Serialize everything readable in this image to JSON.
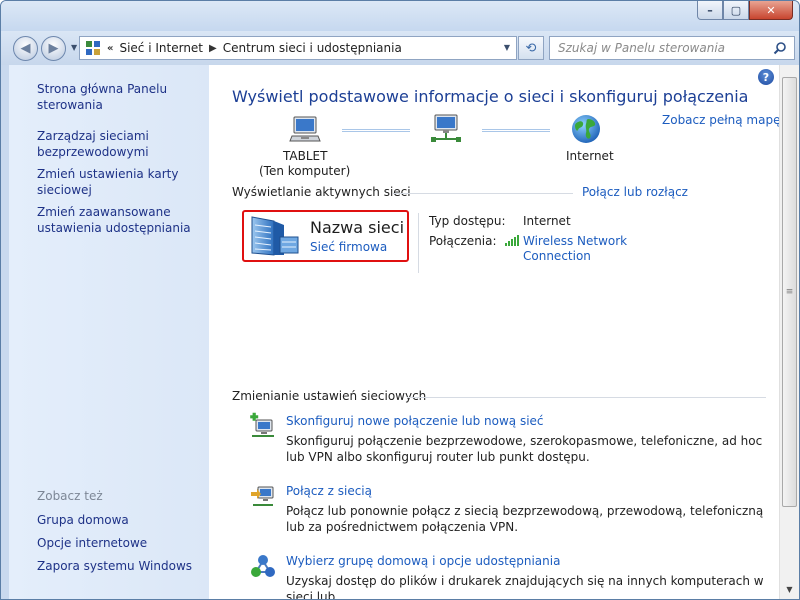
{
  "window": {
    "caption_buttons": {
      "minimize": "–",
      "maximize": "▢",
      "close": "✕"
    }
  },
  "navigation": {
    "breadcrumb_overflow": "«",
    "breadcrumbs": [
      "Sieć i Internet",
      "Centrum sieci i udostępniania"
    ],
    "search_placeholder": "Szukaj w Panelu sterowania"
  },
  "sidebar": {
    "top_links": [
      {
        "label": "Strona główna Panelu sterowania"
      },
      {
        "label": "Zarządzaj sieciami bezprzewodowymi"
      },
      {
        "label": "Zmień ustawienia karty sieciowej"
      },
      {
        "label": "Zmień zaawansowane ustawienia udostępniania"
      }
    ],
    "see_also_label": "Zobacz też",
    "see_also_links": [
      {
        "label": "Grupa domowa"
      },
      {
        "label": "Opcje internetowe"
      },
      {
        "label": "Zapora systemu Windows"
      }
    ]
  },
  "main": {
    "heading": "Wyświetl podstawowe informacje o sieci i skonfiguruj połączenia",
    "see_full_map": "Zobacz pełną mapę",
    "map": {
      "computer_name": "TABLET",
      "computer_sub": "(Ten komputer)",
      "internet_label": "Internet"
    },
    "active_networks": {
      "title": "Wyświetlanie aktywnych sieci",
      "connect_link": "Połącz lub rozłącz",
      "network_name": "Nazwa sieci",
      "network_type": "Sieć firmowa",
      "access_type_label": "Typ dostępu:",
      "access_type_value": "Internet",
      "connections_label": "Połączenia:",
      "connection_line1": "Wireless Network",
      "connection_line2": "Connection"
    },
    "change_settings": {
      "title": "Zmienianie ustawień sieciowych",
      "tasks": [
        {
          "title": "Skonfiguruj nowe połączenie lub nową sieć",
          "desc": "Skonfiguruj połączenie bezprzewodowe, szerokopasmowe, telefoniczne, ad hoc lub VPN albo skonfiguruj router lub punkt dostępu."
        },
        {
          "title": "Połącz z siecią",
          "desc": "Połącz lub ponownie połącz z siecią bezprzewodową, przewodową, telefoniczną lub za pośrednictwem połączenia VPN."
        },
        {
          "title": "Wybierz grupę domową i opcje udostępniania",
          "desc": "Uzyskaj dostęp do plików i drukarek znajdujących się na innych komputerach w sieci lub"
        }
      ]
    }
  },
  "colors": {
    "link": "#1c5cbf",
    "heading": "#1c3f95",
    "highlight_border": "#e01010",
    "sidebar_link": "#1e3287"
  }
}
